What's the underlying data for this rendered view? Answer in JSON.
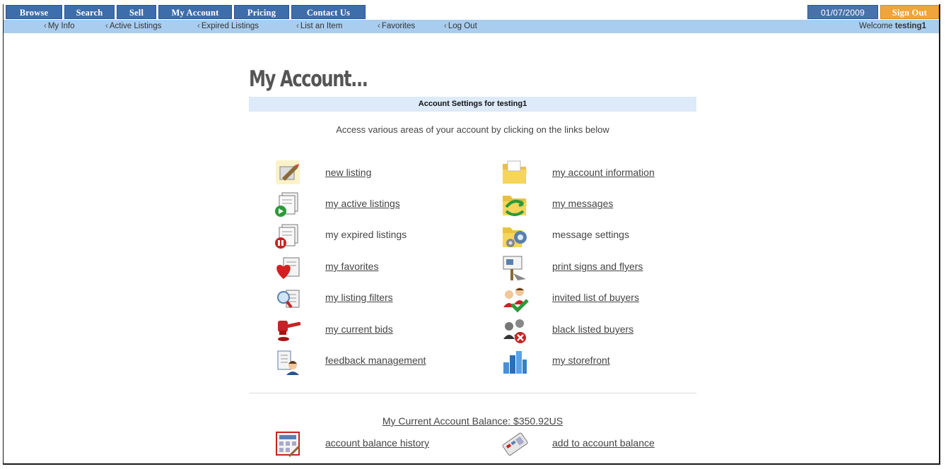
{
  "tabs": {
    "browse": "Browse",
    "search": "Search",
    "sell": "Sell",
    "my_account": "My Account",
    "pricing": "Pricing",
    "contact": "Contact Us",
    "date": "01/07/2009",
    "sign_out": "Sign Out"
  },
  "subnav": {
    "items": [
      "My Info",
      "Active Listings",
      "Expired Listings",
      "List an Item",
      "Favorites",
      "Log Out"
    ],
    "welcome_prefix": "Welcome",
    "username": "testing1"
  },
  "page": {
    "title": "My Account...",
    "settings_heading": "Account Settings for testing1",
    "intro": "Access various areas of your account by clicking on the links below"
  },
  "left_links": [
    {
      "label": "new listing",
      "icon": "new-listing-icon"
    },
    {
      "label": "my active listings",
      "icon": "active-listings-icon"
    },
    {
      "label": "my expired listings",
      "icon": "expired-listings-icon"
    },
    {
      "label": "my favorites",
      "icon": "favorites-heart-icon"
    },
    {
      "label": "my listing filters",
      "icon": "listing-filters-icon"
    },
    {
      "label": "my current bids",
      "icon": "auction-gavel-icon"
    },
    {
      "label": "feedback management",
      "icon": "feedback-icon"
    }
  ],
  "right_links": [
    {
      "label": "my account information",
      "icon": "folder-icon"
    },
    {
      "label": "my messages",
      "icon": "messages-icon"
    },
    {
      "label": "message settings",
      "icon": "message-settings-icon"
    },
    {
      "label": "print signs and flyers",
      "icon": "sign-icon"
    },
    {
      "label": "invited list of buyers",
      "icon": "invited-buyers-icon"
    },
    {
      "label": "black listed buyers",
      "icon": "blacklisted-buyers-icon"
    },
    {
      "label": "my storefront",
      "icon": "storefront-icon"
    }
  ],
  "balance": {
    "text": "My Current Account Balance: $350.92US",
    "history_label": "account balance history",
    "add_label": "add to account balance"
  },
  "colors": {
    "tab": "#3e6dab",
    "sign_out": "#f0a43c",
    "subnav": "#a9cdee",
    "settings_bar": "#dceafa"
  }
}
